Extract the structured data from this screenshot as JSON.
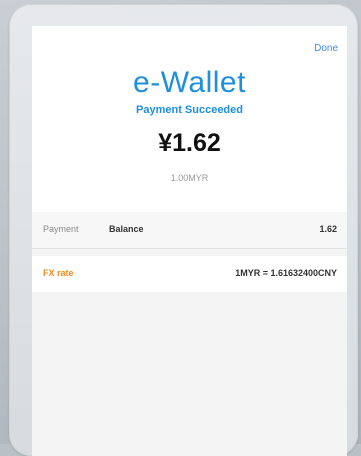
{
  "header": {
    "done_label": "Done",
    "app_title": "e-Wallet",
    "status_text": "Payment Succeeded",
    "amount": "¥1.62",
    "sub_amount": "1.00MYR"
  },
  "payment": {
    "label": "Payment",
    "method": "Balance",
    "value": "1.62"
  },
  "fx": {
    "label": "FX rate",
    "value": "1MYR = 1.61632400CNY"
  },
  "colors": {
    "accent_blue": "#1e8fdc",
    "fx_orange": "#f08a1c",
    "done_blue": "#3a8de0"
  }
}
